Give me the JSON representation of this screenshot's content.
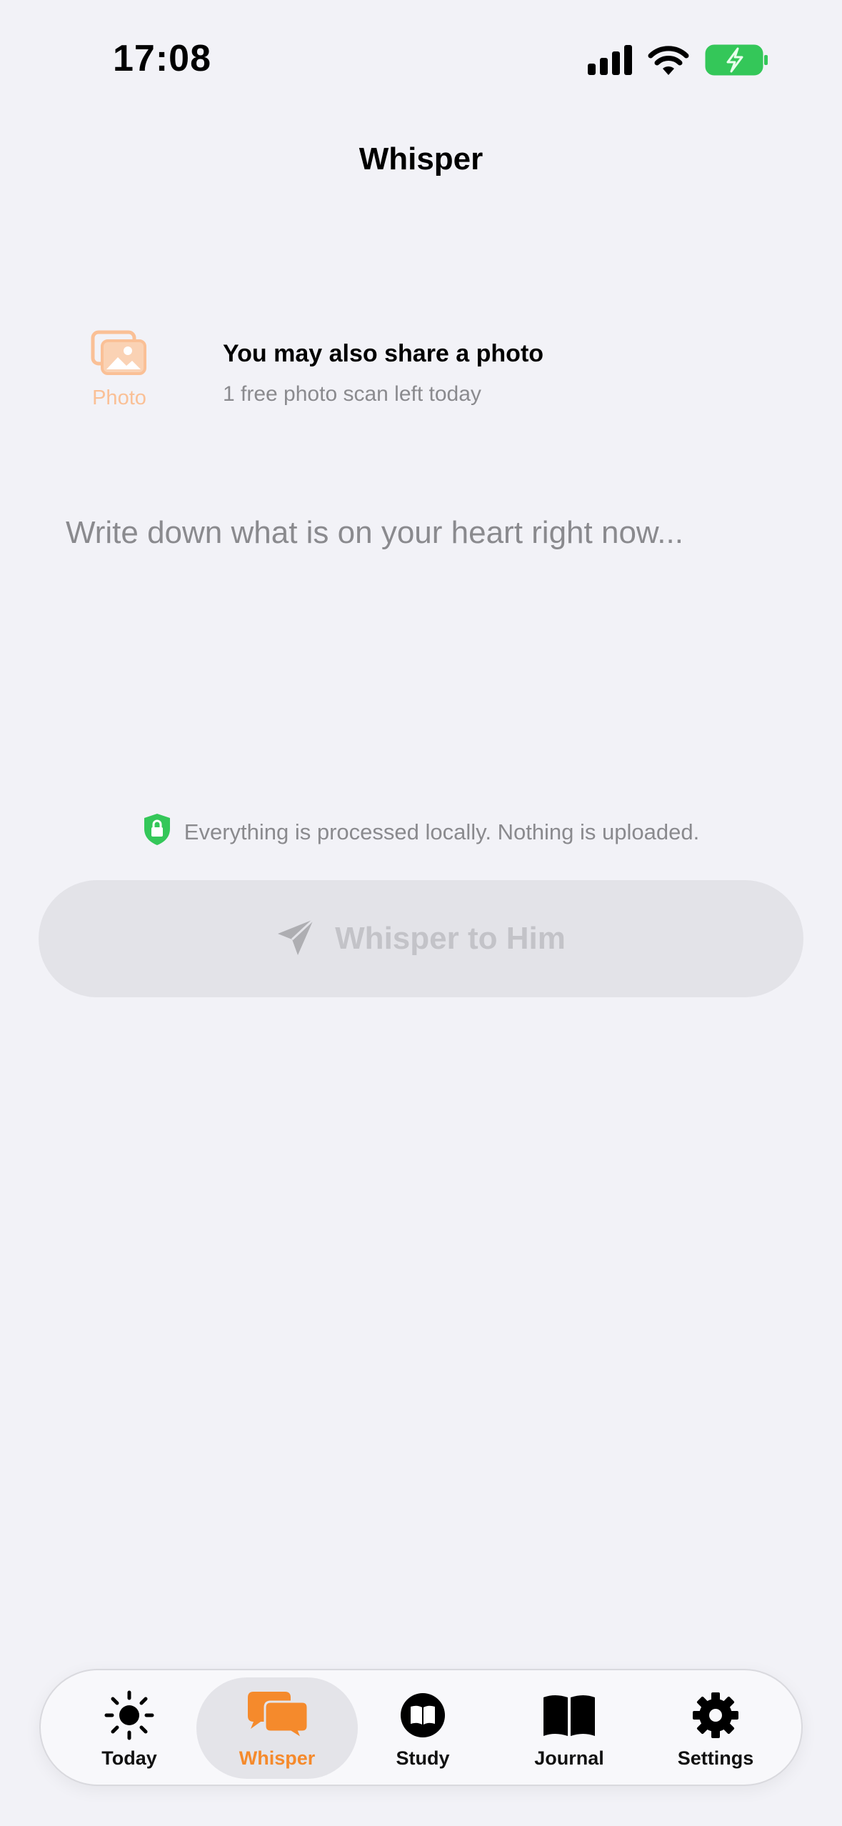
{
  "status_bar": {
    "time": "17:08"
  },
  "nav": {
    "title": "Whisper"
  },
  "photo": {
    "button_label": "Photo",
    "title": "You may also share a photo",
    "subtitle": "1 free photo scan left today"
  },
  "entry": {
    "placeholder": "Write down what is on your heart right now..."
  },
  "privacy": {
    "text": "Everything is processed locally. Nothing is uploaded."
  },
  "primary_button": {
    "label": "Whisper to Him",
    "enabled": false
  },
  "tabs": [
    {
      "label": "Today",
      "icon": "sun-icon"
    },
    {
      "label": "Whisper",
      "icon": "chat-bubbles-icon",
      "selected": true
    },
    {
      "label": "Study",
      "icon": "book-circle-icon"
    },
    {
      "label": "Journal",
      "icon": "open-book-icon"
    },
    {
      "label": "Settings",
      "icon": "gear-icon"
    }
  ],
  "colors": {
    "accent": "#F58A2C",
    "accent_muted": "#FAC096",
    "background": "#F2F2F7",
    "secure_green": "#34C759",
    "battery_green": "#34C759"
  }
}
